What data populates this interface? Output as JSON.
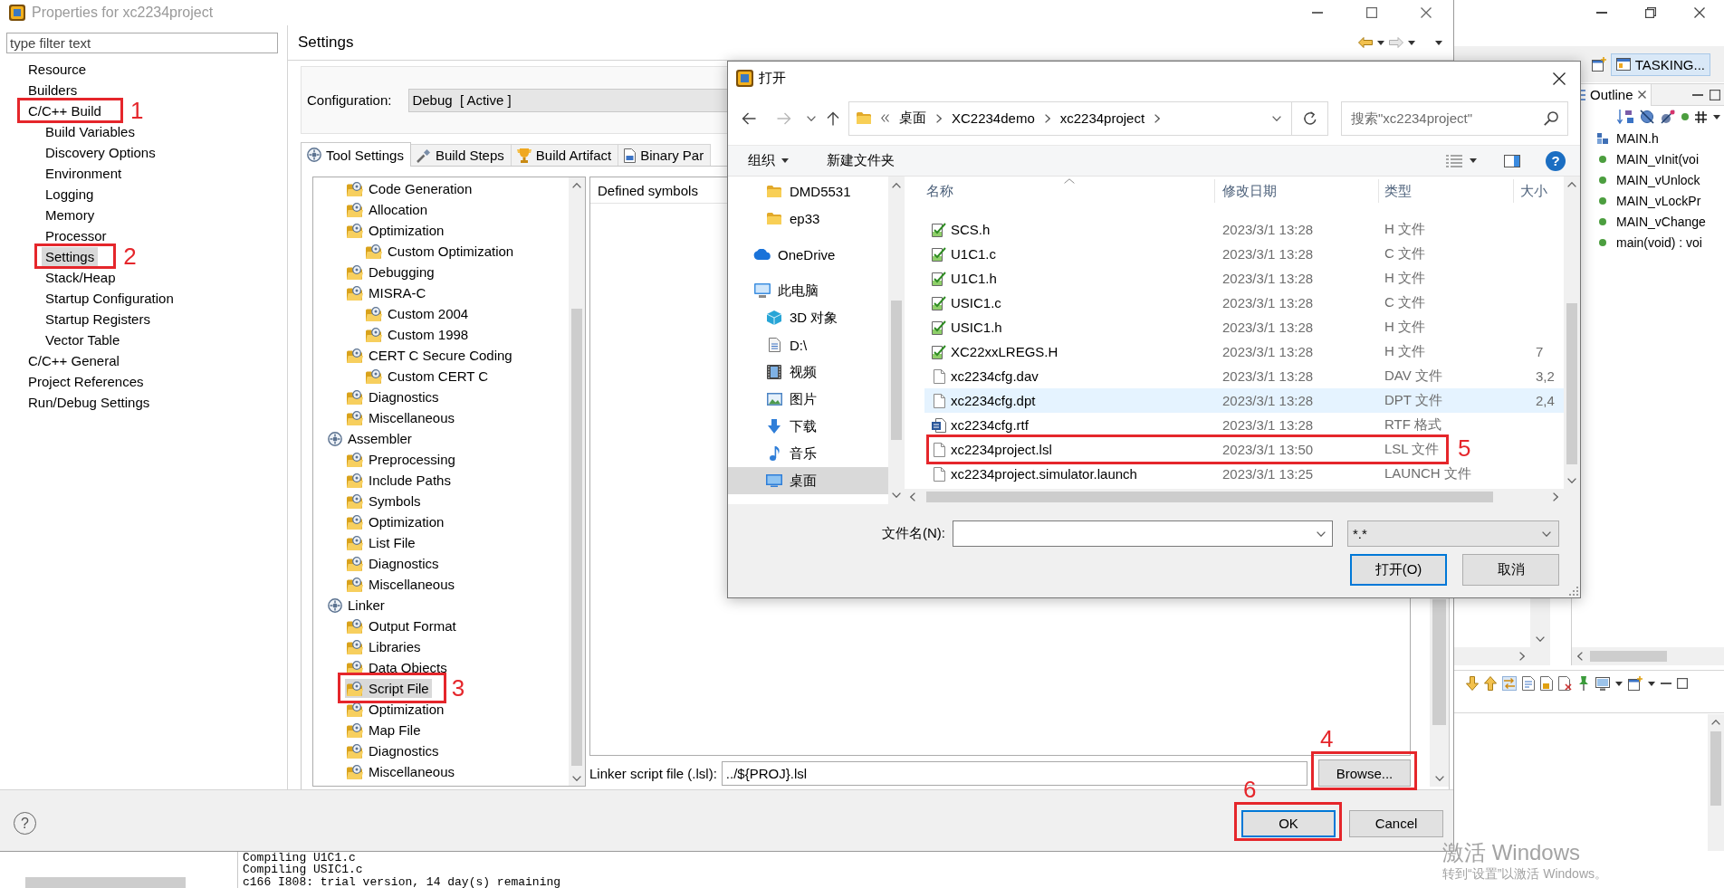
{
  "properties_dialog": {
    "title": "Properties for xc2234project",
    "filter": {
      "placeholder": "type filter text"
    },
    "pages": [
      {
        "label": "Resource",
        "selected": false
      },
      {
        "label": "Builders",
        "selected": false
      },
      {
        "label": "C/C++ Build",
        "selected": false,
        "annotation": "1",
        "children": [
          {
            "label": "Build Variables",
            "selected": false
          },
          {
            "label": "Discovery Options",
            "selected": false
          },
          {
            "label": "Environment",
            "selected": false
          },
          {
            "label": "Logging",
            "selected": false
          },
          {
            "label": "Memory",
            "selected": false
          },
          {
            "label": "Processor",
            "selected": false
          },
          {
            "label": "Settings",
            "selected": true,
            "annotation": "2"
          },
          {
            "label": "Stack/Heap",
            "selected": false
          },
          {
            "label": "Startup Configuration",
            "selected": false
          },
          {
            "label": "Startup Registers",
            "selected": false
          },
          {
            "label": "Vector Table",
            "selected": false
          }
        ]
      },
      {
        "label": "C/C++ General",
        "selected": false
      },
      {
        "label": "Project References",
        "selected": false
      },
      {
        "label": "Run/Debug Settings",
        "selected": false
      }
    ],
    "page_title": "Settings",
    "configuration": {
      "label": "Configuration:",
      "value": "Debug  [ Active ]"
    },
    "tabs": [
      {
        "label": "Tool Settings",
        "kind": "tool",
        "selected": true
      },
      {
        "label": "Build Steps",
        "kind": "steps",
        "selected": false
      },
      {
        "label": "Build Artifact",
        "kind": "artifact",
        "selected": false
      },
      {
        "label": "Binary Par",
        "kind": "binary",
        "selected": false
      }
    ],
    "tool_tree": [
      {
        "children": [
          {
            "label": "Code Generation",
            "kind": "options",
            "selected": false
          },
          {
            "label": "Allocation",
            "kind": "options",
            "selected": false
          },
          {
            "label": "Optimization",
            "kind": "options",
            "selected": false,
            "children": [
              {
                "label": "Custom Optimization",
                "kind": "options",
                "selected": false
              }
            ]
          },
          {
            "label": "Debugging",
            "kind": "options",
            "selected": false
          },
          {
            "label": "MISRA-C",
            "kind": "options",
            "selected": false,
            "children": [
              {
                "label": "Custom 2004",
                "kind": "options",
                "selected": false
              },
              {
                "label": "Custom 1998",
                "kind": "options",
                "selected": false
              }
            ]
          },
          {
            "label": "CERT C Secure Coding",
            "kind": "options",
            "selected": false,
            "children": [
              {
                "label": "Custom CERT C",
                "kind": "options",
                "selected": false
              }
            ]
          },
          {
            "label": "Diagnostics",
            "kind": "options",
            "selected": false
          },
          {
            "label": "Miscellaneous",
            "kind": "options",
            "selected": false
          }
        ]
      },
      {
        "label": "Assembler",
        "kind": "tool",
        "selected": false,
        "children": [
          {
            "label": "Preprocessing",
            "kind": "options",
            "selected": false
          },
          {
            "label": "Include Paths",
            "kind": "options",
            "selected": false
          },
          {
            "label": "Symbols",
            "kind": "options",
            "selected": false
          },
          {
            "label": "Optimization",
            "kind": "options",
            "selected": false
          },
          {
            "label": "List File",
            "kind": "options",
            "selected": false
          },
          {
            "label": "Diagnostics",
            "kind": "options",
            "selected": false
          },
          {
            "label": "Miscellaneous",
            "kind": "options",
            "selected": false
          }
        ]
      },
      {
        "label": "Linker",
        "kind": "tool",
        "selected": false,
        "children": [
          {
            "label": "Output Format",
            "kind": "options",
            "selected": false
          },
          {
            "label": "Libraries",
            "kind": "options",
            "selected": false
          },
          {
            "label": "Data Objects",
            "kind": "options",
            "selected": false
          },
          {
            "label": "Script File",
            "kind": "options",
            "selected": true,
            "annotation": "3"
          },
          {
            "label": "Optimization",
            "kind": "options",
            "selected": false
          },
          {
            "label": "Map File",
            "kind": "options",
            "selected": false
          },
          {
            "label": "Diagnostics",
            "kind": "options",
            "selected": false
          },
          {
            "label": "Miscellaneous",
            "kind": "options",
            "selected": false
          }
        ]
      }
    ],
    "symbols": {
      "header": "Defined symbols"
    },
    "linker_script": {
      "label": "Linker script file (.lsl):",
      "value": "../${PROJ}.lsl"
    },
    "browse": {
      "label": "Browse...",
      "annotation": "4"
    },
    "help": "?",
    "buttons": [
      {
        "label": "OK",
        "default": true,
        "annotation": "6"
      },
      {
        "label": "Cancel",
        "default": false
      }
    ]
  },
  "open_dialog": {
    "title": "打开",
    "path": [
      "桌面",
      "XC2234demo",
      "xc2234project"
    ],
    "search": {
      "placeholder": "搜索\"xc2234project\""
    },
    "organize": "组织",
    "new_folder": "新建文件夹",
    "help": "?",
    "nav": [
      {
        "children": [
          {
            "label": "DMD5531",
            "kind": "folder",
            "selected": false
          },
          {
            "label": "ep33",
            "kind": "folder",
            "selected": false
          }
        ]
      },
      {
        "label": "OneDrive",
        "kind": "cloud",
        "selected": false
      },
      {
        "label": "此电脑",
        "kind": "computer",
        "selected": false,
        "children": [
          {
            "label": "3D 对象",
            "kind": "objects",
            "selected": false
          },
          {
            "label": "D:\\",
            "kind": "drive",
            "selected": false
          },
          {
            "label": "视频",
            "kind": "videos",
            "selected": false
          },
          {
            "label": "图片",
            "kind": "pictures",
            "selected": false
          },
          {
            "label": "下载",
            "kind": "downloads",
            "selected": false
          },
          {
            "label": "音乐",
            "kind": "music",
            "selected": false
          },
          {
            "label": "桌面",
            "kind": "desktop",
            "selected": true
          }
        ]
      }
    ],
    "columns": [
      {
        "label": "名称",
        "sorted": true
      },
      {
        "label": "修改日期",
        "sorted": false
      },
      {
        "label": "类型",
        "sorted": false
      },
      {
        "label": "大小",
        "sorted": false
      }
    ],
    "files": [
      {
        "name": "SCS.h",
        "modified": "2023/3/1 13:28",
        "type": "H 文件",
        "kind": "source",
        "selected": false,
        "hovered": false
      },
      {
        "name": "U1C1.c",
        "modified": "2023/3/1 13:28",
        "type": "C 文件",
        "kind": "source",
        "selected": false,
        "hovered": false
      },
      {
        "name": "U1C1.h",
        "modified": "2023/3/1 13:28",
        "type": "H 文件",
        "kind": "source",
        "selected": false,
        "hovered": false
      },
      {
        "name": "USIC1.c",
        "modified": "2023/3/1 13:28",
        "type": "C 文件",
        "kind": "source",
        "selected": false,
        "hovered": false
      },
      {
        "name": "USIC1.h",
        "modified": "2023/3/1 13:28",
        "type": "H 文件",
        "kind": "source",
        "selected": false,
        "hovered": false
      },
      {
        "name": "XC22xxLREGS.H",
        "modified": "2023/3/1 13:28",
        "type": "H 文件",
        "kind": "source",
        "size": "7",
        "selected": false,
        "hovered": false
      },
      {
        "name": "xc2234cfg.dav",
        "modified": "2023/3/1 13:28",
        "type": "DAV 文件",
        "kind": "blank",
        "size": "3,2",
        "selected": false,
        "hovered": false
      },
      {
        "name": "xc2234cfg.dpt",
        "modified": "2023/3/1 13:28",
        "type": "DPT 文件",
        "kind": "blank",
        "size": "2,4",
        "selected": false,
        "hovered": true
      },
      {
        "name": "xc2234cfg.rtf",
        "modified": "2023/3/1 13:28",
        "type": "RTF 格式",
        "kind": "word",
        "selected": false,
        "hovered": false
      },
      {
        "name": "xc2234project.lsl",
        "modified": "2023/3/1 13:50",
        "type": "LSL 文件",
        "kind": "blank",
        "selected": false,
        "hovered": false,
        "annotation": "5"
      },
      {
        "name": "xc2234project.simulator.launch",
        "modified": "2023/3/1 13:25",
        "type": "LAUNCH 文件",
        "kind": "blank",
        "selected": false,
        "hovered": false
      }
    ],
    "filename": {
      "label": "文件名(N):"
    },
    "filter": {
      "value": "*.*"
    },
    "buttons": [
      {
        "label": "打开(O)",
        "default": true
      },
      {
        "label": "取消",
        "default": false
      }
    ]
  },
  "ide": {
    "perspective": {
      "label": "TASKING...",
      "selected": true
    },
    "outline": {
      "title": "Outline",
      "items": [
        {
          "label": "MAIN.h",
          "kind": "include"
        },
        {
          "label": "MAIN_vInit(voi",
          "kind": "function"
        },
        {
          "label": "MAIN_vUnlock",
          "kind": "function"
        },
        {
          "label": "MAIN_vLockPr",
          "kind": "function"
        },
        {
          "label": "MAIN_vChange",
          "kind": "function"
        },
        {
          "label": "main(void) : voi",
          "kind": "function"
        }
      ]
    },
    "console": {
      "lines": [
        "Compiling U1C1.c",
        "Compiling USIC1.c",
        "c166 I808: trial version, 14 day(s) remaining"
      ]
    }
  },
  "activation_notice": {
    "title": "激活 Windows",
    "hint": "转到“设置”以激活 Windows。"
  }
}
